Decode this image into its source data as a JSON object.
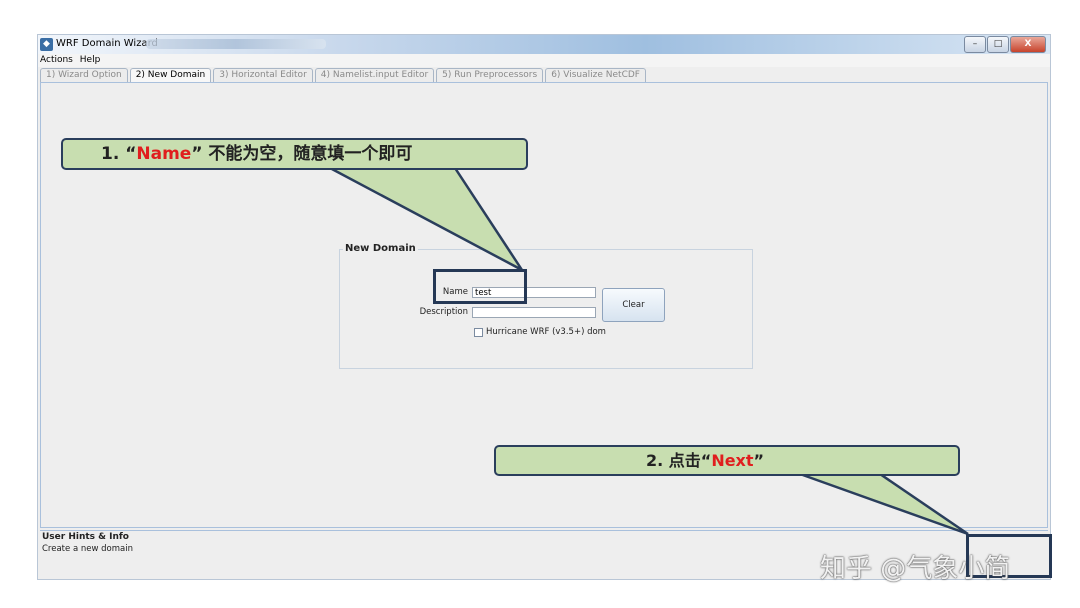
{
  "window": {
    "title": "WRF Domain Wizard",
    "buttons": {
      "minimize": "–",
      "maximize": "□",
      "close": "X"
    }
  },
  "menu": [
    "Actions",
    "Help"
  ],
  "tabs": [
    {
      "label": "1) Wizard Option",
      "active": false
    },
    {
      "label": "2) New Domain",
      "active": true
    },
    {
      "label": "3) Horizontal Editor",
      "active": false
    },
    {
      "label": "4) Namelist.input Editor",
      "active": false
    },
    {
      "label": "5) Run Preprocessors",
      "active": false
    },
    {
      "label": "6) Visualize NetCDF",
      "active": false
    }
  ],
  "new_domain": {
    "title": "New Domain",
    "name_label": "Name",
    "name_value": "test",
    "description_label": "Description",
    "description_value": "",
    "clear_label": "Clear",
    "hurricane_label": "Hurricane WRF (v3.5+) dom",
    "hurricane_checked": false
  },
  "hints": {
    "title": "User Hints & Info",
    "text": "Create a new domain"
  },
  "annotations": {
    "callout1": {
      "prefix": "1. “",
      "highlight": "Name",
      "suffix": "” 不能为空，随意填一个即可"
    },
    "callout2": {
      "prefix": "2. 点击“",
      "highlight": "Next",
      "suffix": "”"
    }
  },
  "watermark": "知乎 @气象小简",
  "colors": {
    "callout_fill": "#c8deb0",
    "callout_border": "#2a3e5c",
    "highlight_red": "#e01e1e"
  }
}
